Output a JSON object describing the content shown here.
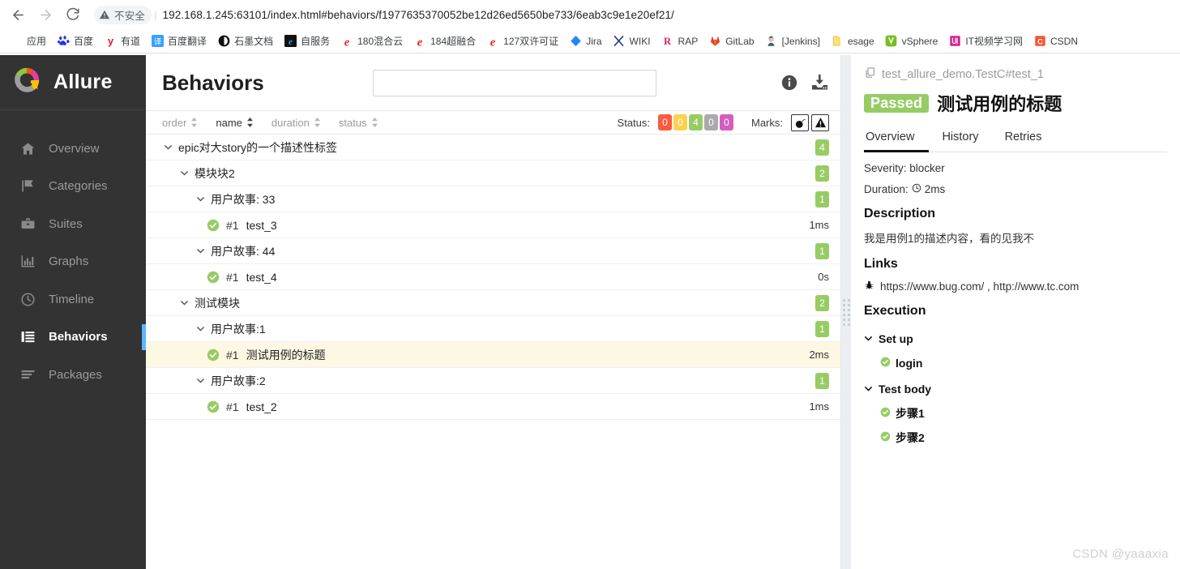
{
  "browser": {
    "back_icon": "arrow-left-icon",
    "forward_icon": "arrow-right-icon",
    "reload_icon": "reload-icon",
    "security_label": "不安全",
    "separator": "|",
    "url": "192.168.1.245:63101/index.html#behaviors/f1977635370052be12d26ed5650be733/6eab3c9e1e20ef21/",
    "bookmarks": [
      {
        "label": "应用",
        "icon": "apps-grid-icon"
      },
      {
        "label": "百度",
        "icon": "baidu-icon"
      },
      {
        "label": "有道",
        "icon": "youdao-icon"
      },
      {
        "label": "百度翻译",
        "icon": "baidu-translate-icon"
      },
      {
        "label": "石墨文档",
        "icon": "shimo-docs-icon"
      },
      {
        "label": "自服务",
        "icon": "ie-icon"
      },
      {
        "label": "180混合云",
        "icon": "ie-red-icon"
      },
      {
        "label": "184超融合",
        "icon": "ie-red-icon"
      },
      {
        "label": "127双许可证",
        "icon": "ie-red-icon"
      },
      {
        "label": "Jira",
        "icon": "jira-icon"
      },
      {
        "label": "WIKI",
        "icon": "wiki-icon"
      },
      {
        "label": "RAP",
        "icon": "rap-icon"
      },
      {
        "label": "GitLab",
        "icon": "gitlab-icon"
      },
      {
        "label": "[Jenkins]",
        "icon": "jenkins-icon"
      },
      {
        "label": "esage",
        "icon": "folder-icon"
      },
      {
        "label": "vSphere",
        "icon": "vsphere-icon"
      },
      {
        "label": "IT视频学习网",
        "icon": "it-video-icon"
      },
      {
        "label": "CSDN",
        "icon": "csdn-icon"
      }
    ]
  },
  "sidebar": {
    "brand": "Allure",
    "logo_icon": "allure-logo-icon",
    "items": [
      {
        "label": "Overview",
        "icon": "home-icon",
        "active": false
      },
      {
        "label": "Categories",
        "icon": "flag-icon",
        "active": false
      },
      {
        "label": "Suites",
        "icon": "briefcase-icon",
        "active": false
      },
      {
        "label": "Graphs",
        "icon": "bar-chart-icon",
        "active": false
      },
      {
        "label": "Timeline",
        "icon": "clock-icon",
        "active": false
      },
      {
        "label": "Behaviors",
        "icon": "list-icon",
        "active": true
      },
      {
        "label": "Packages",
        "icon": "layers-icon",
        "active": false
      }
    ]
  },
  "main": {
    "title": "Behaviors",
    "search_placeholder": "",
    "search_value": "",
    "info_icon": "info-icon",
    "download_icon": "download-icon",
    "sorters": [
      {
        "label": "order",
        "active": false
      },
      {
        "label": "name",
        "active": true
      },
      {
        "label": "duration",
        "active": false
      },
      {
        "label": "status",
        "active": false
      }
    ],
    "status_label": "Status:",
    "status_chips": [
      {
        "value": "0",
        "color": "#fd5a3e"
      },
      {
        "value": "0",
        "color": "#ffd050"
      },
      {
        "value": "4",
        "color": "#97cc64"
      },
      {
        "value": "0",
        "color": "#aaaaaa"
      },
      {
        "value": "0",
        "color": "#d35ebe"
      }
    ],
    "marks_label": "Marks:",
    "marks": [
      {
        "icon": "bomb-icon"
      },
      {
        "icon": "warning-triangle-icon"
      }
    ],
    "tree": [
      {
        "level": 0,
        "type": "group",
        "label": "epic对大story的一个描述性标签",
        "count": "4",
        "expanded": true
      },
      {
        "level": 1,
        "type": "group",
        "label": "模块块2",
        "count": "2",
        "expanded": true
      },
      {
        "level": 2,
        "type": "group",
        "label": "用户故事: 33",
        "count": "1",
        "expanded": true
      },
      {
        "level": 3,
        "type": "leaf",
        "num": "#1",
        "label": "test_3",
        "duration": "1ms",
        "status": "passed",
        "selected": false
      },
      {
        "level": 2,
        "type": "group",
        "label": "用户故事: 44",
        "count": "1",
        "expanded": true
      },
      {
        "level": 3,
        "type": "leaf",
        "num": "#1",
        "label": "test_4",
        "duration": "0s",
        "status": "passed",
        "selected": false
      },
      {
        "level": 1,
        "type": "group",
        "label": "测试模块",
        "count": "2",
        "expanded": true
      },
      {
        "level": 2,
        "type": "group",
        "label": "用户故事:1",
        "count": "1",
        "expanded": true
      },
      {
        "level": 3,
        "type": "leaf",
        "num": "#1",
        "label": "测试用例的标题",
        "duration": "2ms",
        "status": "passed",
        "selected": true
      },
      {
        "level": 2,
        "type": "group",
        "label": "用户故事:2",
        "count": "1",
        "expanded": true
      },
      {
        "level": 3,
        "type": "leaf",
        "num": "#1",
        "label": "test_2",
        "duration": "1ms",
        "status": "passed",
        "selected": false
      }
    ]
  },
  "detail": {
    "path": "test_allure_demo.TestC#test_1",
    "path_icon": "copy-icon",
    "status_badge": "Passed",
    "status_color": "#97cc64",
    "title": "测试用例的标题",
    "tabs": [
      {
        "label": "Overview",
        "active": true
      },
      {
        "label": "History",
        "active": false
      },
      {
        "label": "Retries",
        "active": false
      }
    ],
    "severity_line": "Severity: blocker",
    "duration_label": "Duration:",
    "duration_icon": "clock-icon",
    "duration_value": "2ms",
    "description_heading": "Description",
    "description_text": "我是用例1的描述内容，看的见我不",
    "links_heading": "Links",
    "link_icon": "bug-icon",
    "links_text": "https://www.bug.com/ , http://www.tc.com",
    "execution_heading": "Execution",
    "execution_groups": [
      {
        "label": "Set up",
        "expanded": true,
        "steps": [
          {
            "label": "login",
            "status": "passed"
          }
        ]
      },
      {
        "label": "Test body",
        "expanded": true,
        "steps": [
          {
            "label": "步骤1",
            "status": "passed"
          },
          {
            "label": "步骤2",
            "status": "passed"
          }
        ]
      }
    ],
    "watermark": "CSDN @yaaaxia"
  }
}
